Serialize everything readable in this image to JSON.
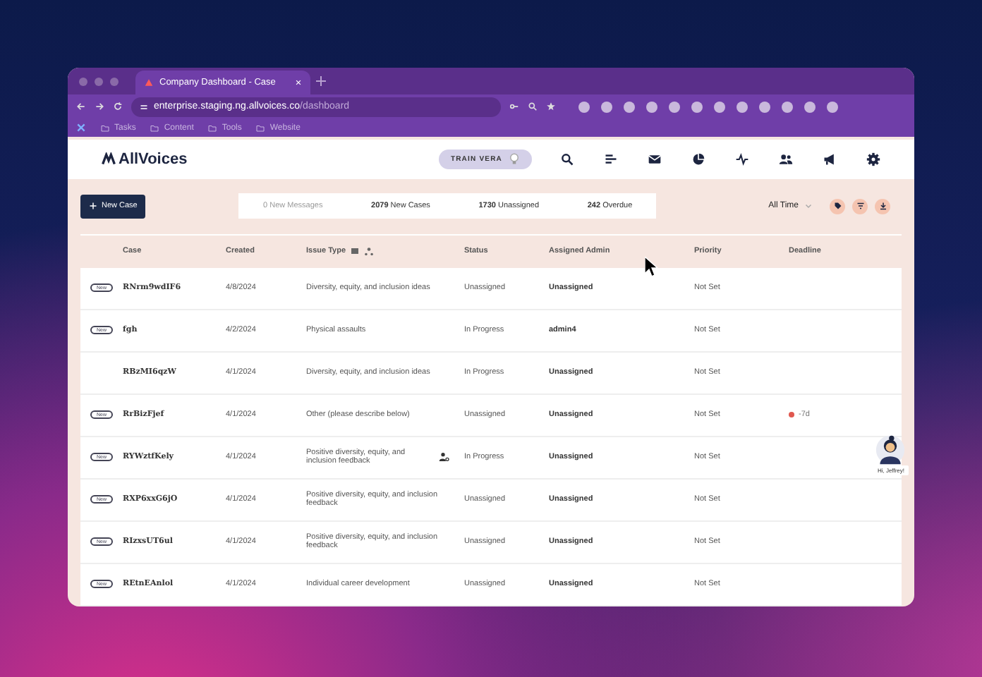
{
  "browser": {
    "tab_title": "Company Dashboard - Case",
    "url_host": "enterprise.staging.ng.allvoices.co",
    "url_path": "/dashboard",
    "bookmarks": [
      "Tasks",
      "Content",
      "Tools",
      "Website"
    ]
  },
  "app": {
    "logo": "AllVoices",
    "train_button": "TRAIN VERA"
  },
  "toolbar": {
    "new_case": "New Case",
    "stats": [
      {
        "count": "0",
        "label": "New Messages",
        "muted": true
      },
      {
        "count": "2079",
        "label": "New Cases",
        "muted": false
      },
      {
        "count": "1730",
        "label": "Unassigned",
        "muted": false
      },
      {
        "count": "242",
        "label": "Overdue",
        "muted": false
      }
    ],
    "period": "All Time"
  },
  "table": {
    "columns": [
      "Case",
      "Created",
      "Issue Type",
      "Status",
      "Assigned Admin",
      "Priority",
      "Deadline"
    ],
    "rows": [
      {
        "badge": "New",
        "case": "RNrm9wdIF6",
        "created": "4/8/2024",
        "issue": "Diversity, equity, and inclusion ideas",
        "assign_icon": false,
        "status": "Unassigned",
        "admin": "Unassigned",
        "priority": "Not Set"
      },
      {
        "badge": "New",
        "case": "fgh",
        "created": "4/2/2024",
        "issue": "Physical assaults",
        "assign_icon": false,
        "status": "In Progress",
        "admin": "admin4",
        "priority": "Not Set"
      },
      {
        "case": "RBzMI6qzW",
        "created": "4/1/2024",
        "issue": "Diversity, equity, and inclusion ideas",
        "assign_icon": false,
        "status": "In Progress",
        "admin": "Unassigned",
        "priority": "Not Set"
      },
      {
        "badge": "New",
        "case": "RrBizFjef",
        "created": "4/1/2024",
        "issue": "Other (please describe below)",
        "assign_icon": false,
        "status": "Unassigned",
        "admin": "Unassigned",
        "priority": "Not Set",
        "deadline": "-7d"
      },
      {
        "badge": "New",
        "case": "RYWztfKely",
        "created": "4/1/2024",
        "issue": "Positive diversity, equity, and inclusion feedback",
        "assign_icon": true,
        "status": "In Progress",
        "admin": "Unassigned",
        "priority": "Not Set"
      },
      {
        "badge": "New",
        "case": "RXP6xxG6jO",
        "created": "4/1/2024",
        "issue": "Positive diversity, equity, and inclusion feedback",
        "assign_icon": false,
        "status": "Unassigned",
        "admin": "Unassigned",
        "priority": "Not Set"
      },
      {
        "badge": "New",
        "case": "RIzxsUT6ul",
        "created": "4/1/2024",
        "issue": "Positive diversity, equity, and inclusion feedback",
        "assign_icon": false,
        "status": "Unassigned",
        "admin": "Unassigned",
        "priority": "Not Set"
      },
      {
        "badge": "New",
        "case": "REtnEAnlol",
        "created": "4/1/2024",
        "issue": "Individual career development",
        "assign_icon": false,
        "status": "Unassigned",
        "admin": "Unassigned",
        "priority": "Not Set"
      }
    ]
  },
  "assistant": {
    "greeting": "Hi, Jeffrey!"
  }
}
